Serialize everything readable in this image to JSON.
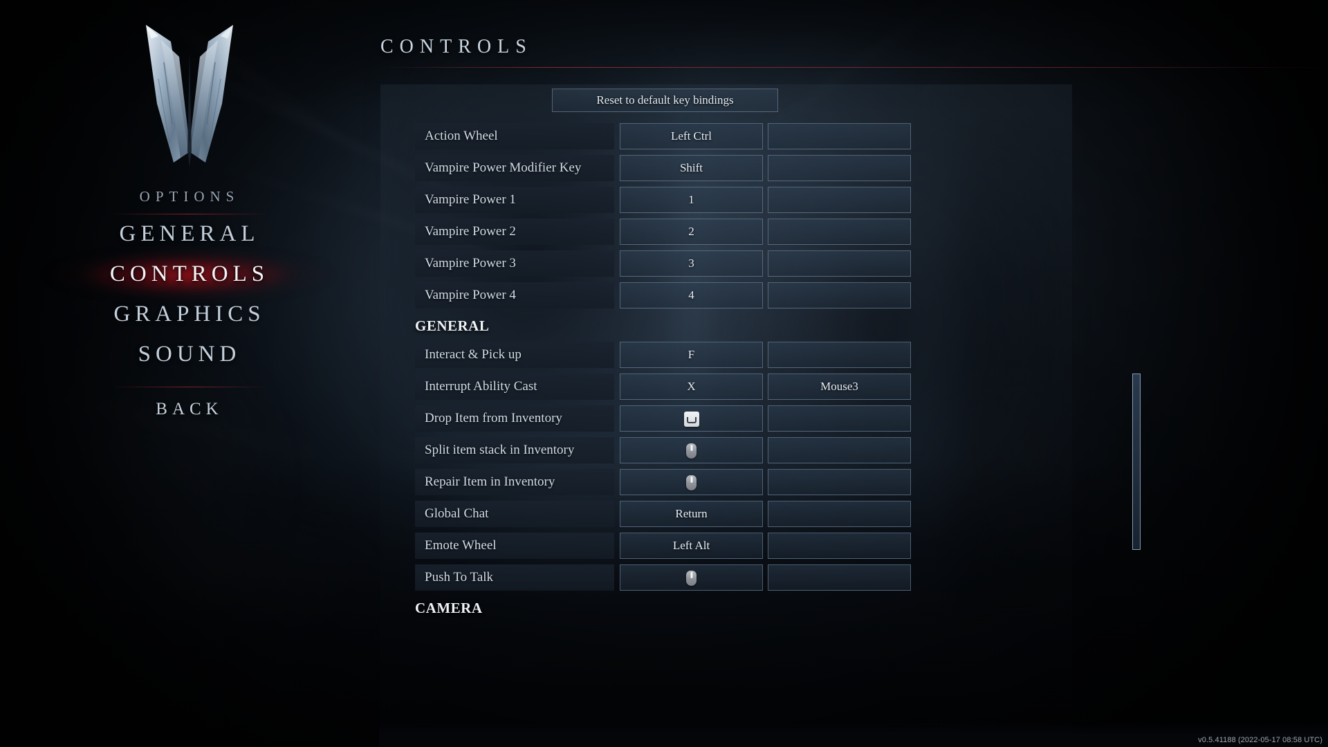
{
  "sidebar": {
    "logo": "vampire-v-logo",
    "options_label": "OPTIONS",
    "items": [
      {
        "label": "GENERAL",
        "active": false
      },
      {
        "label": "CONTROLS",
        "active": true
      },
      {
        "label": "GRAPHICS",
        "active": false
      },
      {
        "label": "SOUND",
        "active": false
      }
    ],
    "back_label": "BACK"
  },
  "content": {
    "page_title": "CONTROLS",
    "reset_button": "Reset to default key bindings",
    "rows": [
      {
        "type": "binding",
        "label": "Action Wheel",
        "primary": "Left Ctrl",
        "secondary": ""
      },
      {
        "type": "binding",
        "label": "Vampire Power Modifier Key",
        "primary": "Shift",
        "secondary": ""
      },
      {
        "type": "binding",
        "label": "Vampire Power 1",
        "primary": "1",
        "secondary": ""
      },
      {
        "type": "binding",
        "label": "Vampire Power 2",
        "primary": "2",
        "secondary": ""
      },
      {
        "type": "binding",
        "label": "Vampire Power 3",
        "primary": "3",
        "secondary": ""
      },
      {
        "type": "binding",
        "label": "Vampire Power 4",
        "primary": "4",
        "secondary": ""
      },
      {
        "type": "section",
        "label": "GENERAL"
      },
      {
        "type": "binding",
        "label": "Interact & Pick up",
        "primary": "F",
        "secondary": ""
      },
      {
        "type": "binding",
        "label": "Interrupt Ability Cast",
        "primary": "X",
        "secondary": "Mouse3"
      },
      {
        "type": "binding",
        "label": "Drop Item from Inventory",
        "primary_icon": "spacebar-key-icon",
        "primary": "",
        "secondary": ""
      },
      {
        "type": "binding",
        "label": "Split item stack in Inventory",
        "primary_icon": "mouse-icon",
        "primary": "",
        "secondary": ""
      },
      {
        "type": "binding",
        "label": "Repair Item in Inventory",
        "primary_icon": "mouse-icon",
        "primary": "",
        "secondary": ""
      },
      {
        "type": "binding",
        "label": "Global Chat",
        "primary": "Return",
        "secondary": ""
      },
      {
        "type": "binding",
        "label": "Emote Wheel",
        "primary": "Left Alt",
        "secondary": ""
      },
      {
        "type": "binding",
        "label": "Push To Talk",
        "primary_icon": "mouse-icon",
        "primary": "",
        "secondary": ""
      },
      {
        "type": "section",
        "label": "CAMERA"
      }
    ]
  },
  "version": "v0.5.41188 (2022-05-17 08:58 UTC)",
  "colors": {
    "accent_red": "#b0303c",
    "highlight_red": "#be121c",
    "text_primary": "#e7eef5",
    "text_muted": "#9aa6b4",
    "box_border": "#8ca8c4"
  }
}
